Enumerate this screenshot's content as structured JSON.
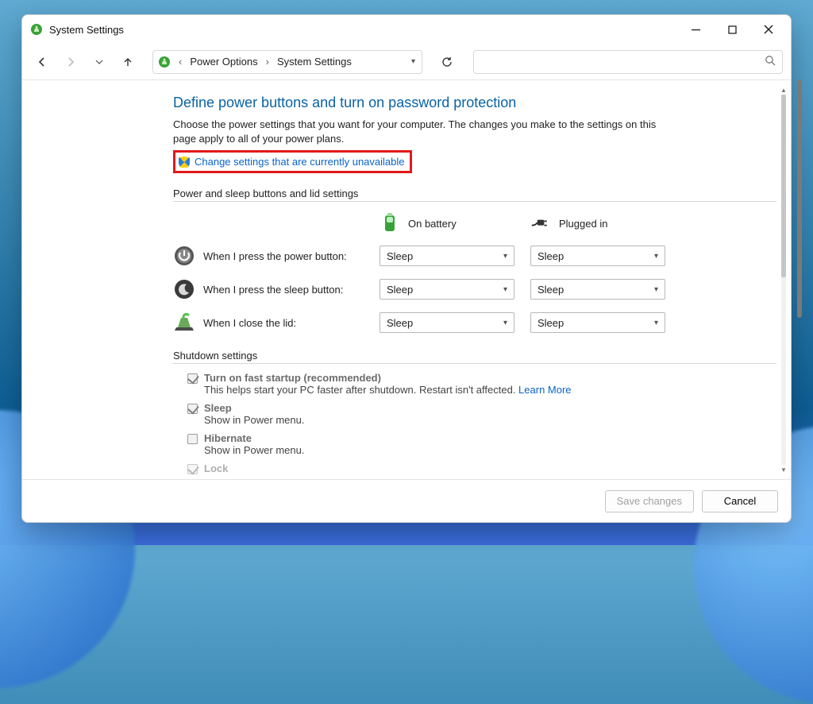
{
  "window": {
    "title": "System Settings"
  },
  "breadcrumb": {
    "items": [
      "Power Options",
      "System Settings"
    ]
  },
  "heading": "Define power buttons and turn on password protection",
  "subtext": "Choose the power settings that you want for your computer. The changes you make to the settings on this page apply to all of your power plans.",
  "change_link": "Change settings that are currently unavailable",
  "section_power": "Power and sleep buttons and lid settings",
  "columns": {
    "battery": "On battery",
    "plugged": "Plugged in"
  },
  "rows": [
    {
      "label": "When I press the power button:",
      "battery": "Sleep",
      "plugged": "Sleep"
    },
    {
      "label": "When I press the sleep button:",
      "battery": "Sleep",
      "plugged": "Sleep"
    },
    {
      "label": "When I close the lid:",
      "battery": "Sleep",
      "plugged": "Sleep"
    }
  ],
  "section_shutdown": "Shutdown settings",
  "shutdown": {
    "fast_startup": {
      "title": "Turn on fast startup (recommended)",
      "desc": "This helps start your PC faster after shutdown. Restart isn't affected.",
      "learn": "Learn More",
      "checked": true
    },
    "sleep": {
      "title": "Sleep",
      "desc": "Show in Power menu.",
      "checked": true
    },
    "hibernate": {
      "title": "Hibernate",
      "desc": "Show in Power menu.",
      "checked": false
    },
    "lock": {
      "title": "Lock"
    }
  },
  "footer": {
    "save": "Save changes",
    "cancel": "Cancel"
  },
  "colors": {
    "link": "#0a63c9",
    "heading": "#0a63a5",
    "highlight_box": "#e11919"
  }
}
